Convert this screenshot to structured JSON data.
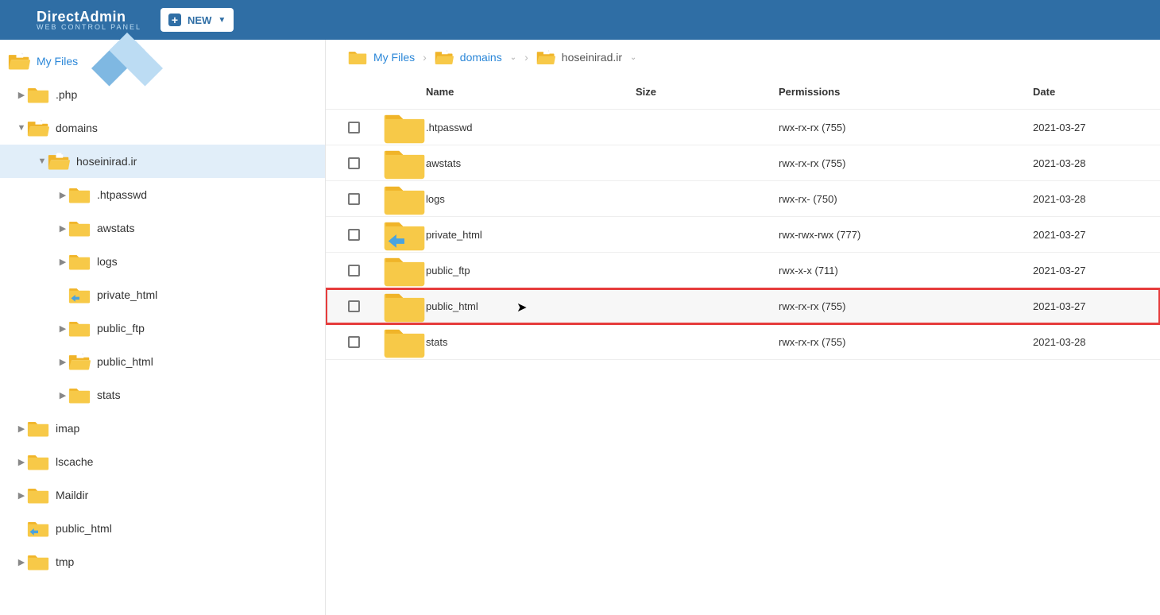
{
  "header": {
    "brand_bold": "Direct",
    "brand_rest": "Admin",
    "brand_sub": "web control panel",
    "new_button": "NEW"
  },
  "sidebar": {
    "root": "My Files",
    "items": [
      {
        "label": ".php",
        "depth": 1,
        "expand": "▶",
        "icon": "folder"
      },
      {
        "label": "domains",
        "depth": 1,
        "expand": "▼",
        "icon": "folder-open"
      },
      {
        "label": "hoseinirad.ir",
        "depth": 2,
        "expand": "▼",
        "icon": "folder-open",
        "selected": true
      },
      {
        "label": ".htpasswd",
        "depth": 3,
        "expand": "▶",
        "icon": "folder"
      },
      {
        "label": "awstats",
        "depth": 3,
        "expand": "▶",
        "icon": "folder"
      },
      {
        "label": "logs",
        "depth": 3,
        "expand": "▶",
        "icon": "folder"
      },
      {
        "label": "private_html",
        "depth": 3,
        "expand": "",
        "icon": "folder-link"
      },
      {
        "label": "public_ftp",
        "depth": 3,
        "expand": "▶",
        "icon": "folder"
      },
      {
        "label": "public_html",
        "depth": 3,
        "expand": "▶",
        "icon": "folder-open"
      },
      {
        "label": "stats",
        "depth": 3,
        "expand": "▶",
        "icon": "folder"
      },
      {
        "label": "imap",
        "depth": 1,
        "expand": "▶",
        "icon": "folder"
      },
      {
        "label": "lscache",
        "depth": 1,
        "expand": "▶",
        "icon": "folder"
      },
      {
        "label": "Maildir",
        "depth": 1,
        "expand": "▶",
        "icon": "folder"
      },
      {
        "label": "public_html",
        "depth": 1,
        "expand": "",
        "icon": "folder-link"
      },
      {
        "label": "tmp",
        "depth": 1,
        "expand": "▶",
        "icon": "folder"
      }
    ]
  },
  "breadcrumb": [
    {
      "label": "My Files",
      "icon": "folder",
      "caret": false
    },
    {
      "label": "domains",
      "icon": "folder-open",
      "caret": true
    },
    {
      "label": "hoseinirad.ir",
      "icon": "folder-open",
      "caret": true,
      "current": true
    }
  ],
  "table": {
    "columns": {
      "name": "Name",
      "size": "Size",
      "permissions": "Permissions",
      "date": "Date"
    },
    "rows": [
      {
        "name": ".htpasswd",
        "size": "",
        "perm": "rwx-rx-rx (755)",
        "date": "2021-03-27",
        "icon": "folder"
      },
      {
        "name": "awstats",
        "size": "",
        "perm": "rwx-rx-rx (755)",
        "date": "2021-03-28",
        "icon": "folder"
      },
      {
        "name": "logs",
        "size": "",
        "perm": "rwx-rx- (750)",
        "date": "2021-03-28",
        "icon": "folder"
      },
      {
        "name": "private_html",
        "size": "",
        "perm": "rwx-rwx-rwx (777)",
        "date": "2021-03-27",
        "icon": "folder-link"
      },
      {
        "name": "public_ftp",
        "size": "",
        "perm": "rwx-x-x (711)",
        "date": "2021-03-27",
        "icon": "folder"
      },
      {
        "name": "public_html",
        "size": "",
        "perm": "rwx-rx-rx (755)",
        "date": "2021-03-27",
        "icon": "folder",
        "highlight": true
      },
      {
        "name": "stats",
        "size": "",
        "perm": "rwx-rx-rx (755)",
        "date": "2021-03-28",
        "icon": "folder"
      }
    ]
  }
}
